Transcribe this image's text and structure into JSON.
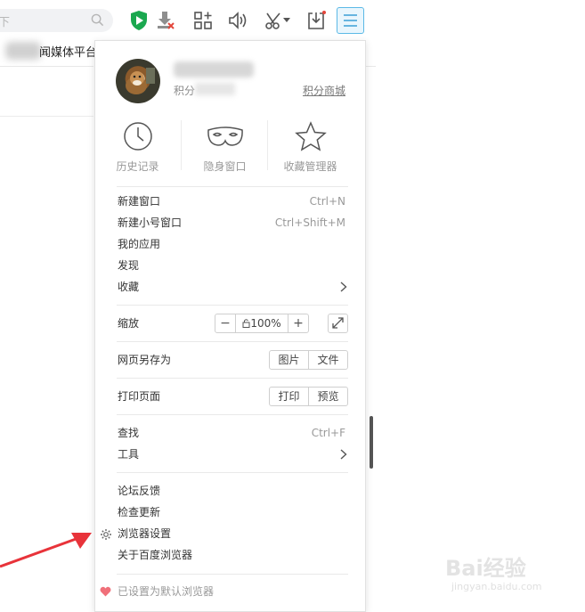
{
  "toolbar": {
    "search_placeholder": "下",
    "tab_title": "闻媒体平台",
    "icons": [
      "search-icon",
      "shield-play-icon",
      "download-blocked-icon",
      "apps-add-icon",
      "speaker-icon",
      "scissors-icon",
      "caret-down-icon",
      "download-tray-icon",
      "menu-icon"
    ],
    "accent": "#5bb9e6",
    "shield_color": "#1aa84f"
  },
  "menu": {
    "user": {
      "points_label": "积分",
      "mall_link": "积分商城"
    },
    "quick_actions": [
      {
        "label": "历史记录",
        "icon": "clock-icon"
      },
      {
        "label": "隐身窗口",
        "icon": "mask-icon"
      },
      {
        "label": "收藏管理器",
        "icon": "star-icon"
      }
    ],
    "group1": [
      {
        "label": "新建窗口",
        "shortcut": "Ctrl+N"
      },
      {
        "label": "新建小号窗口",
        "shortcut": "Ctrl+Shift+M"
      },
      {
        "label": "我的应用"
      },
      {
        "label": "发现"
      },
      {
        "label": "收藏",
        "submenu": true
      }
    ],
    "zoom": {
      "label": "缩放",
      "minus": "−",
      "value": "100%",
      "plus": "+"
    },
    "save_page": {
      "label": "网页另存为",
      "btn1": "图片",
      "btn2": "文件"
    },
    "print_page": {
      "label": "打印页面",
      "btn1": "打印",
      "btn2": "预览"
    },
    "group3": [
      {
        "label": "查找",
        "shortcut": "Ctrl+F"
      },
      {
        "label": "工具",
        "submenu": true
      }
    ],
    "group4": [
      {
        "label": "论坛反馈"
      },
      {
        "label": "检查更新"
      },
      {
        "label": "浏览器设置",
        "icon": "gear-icon"
      },
      {
        "label": "关于百度浏览器"
      }
    ],
    "footer": {
      "label": "已设置为默认浏览器",
      "icon": "heart-icon",
      "heart_color": "#f0707a"
    }
  },
  "watermark": {
    "text": "Bai经验",
    "sub": "jingyan.baidu.com"
  }
}
